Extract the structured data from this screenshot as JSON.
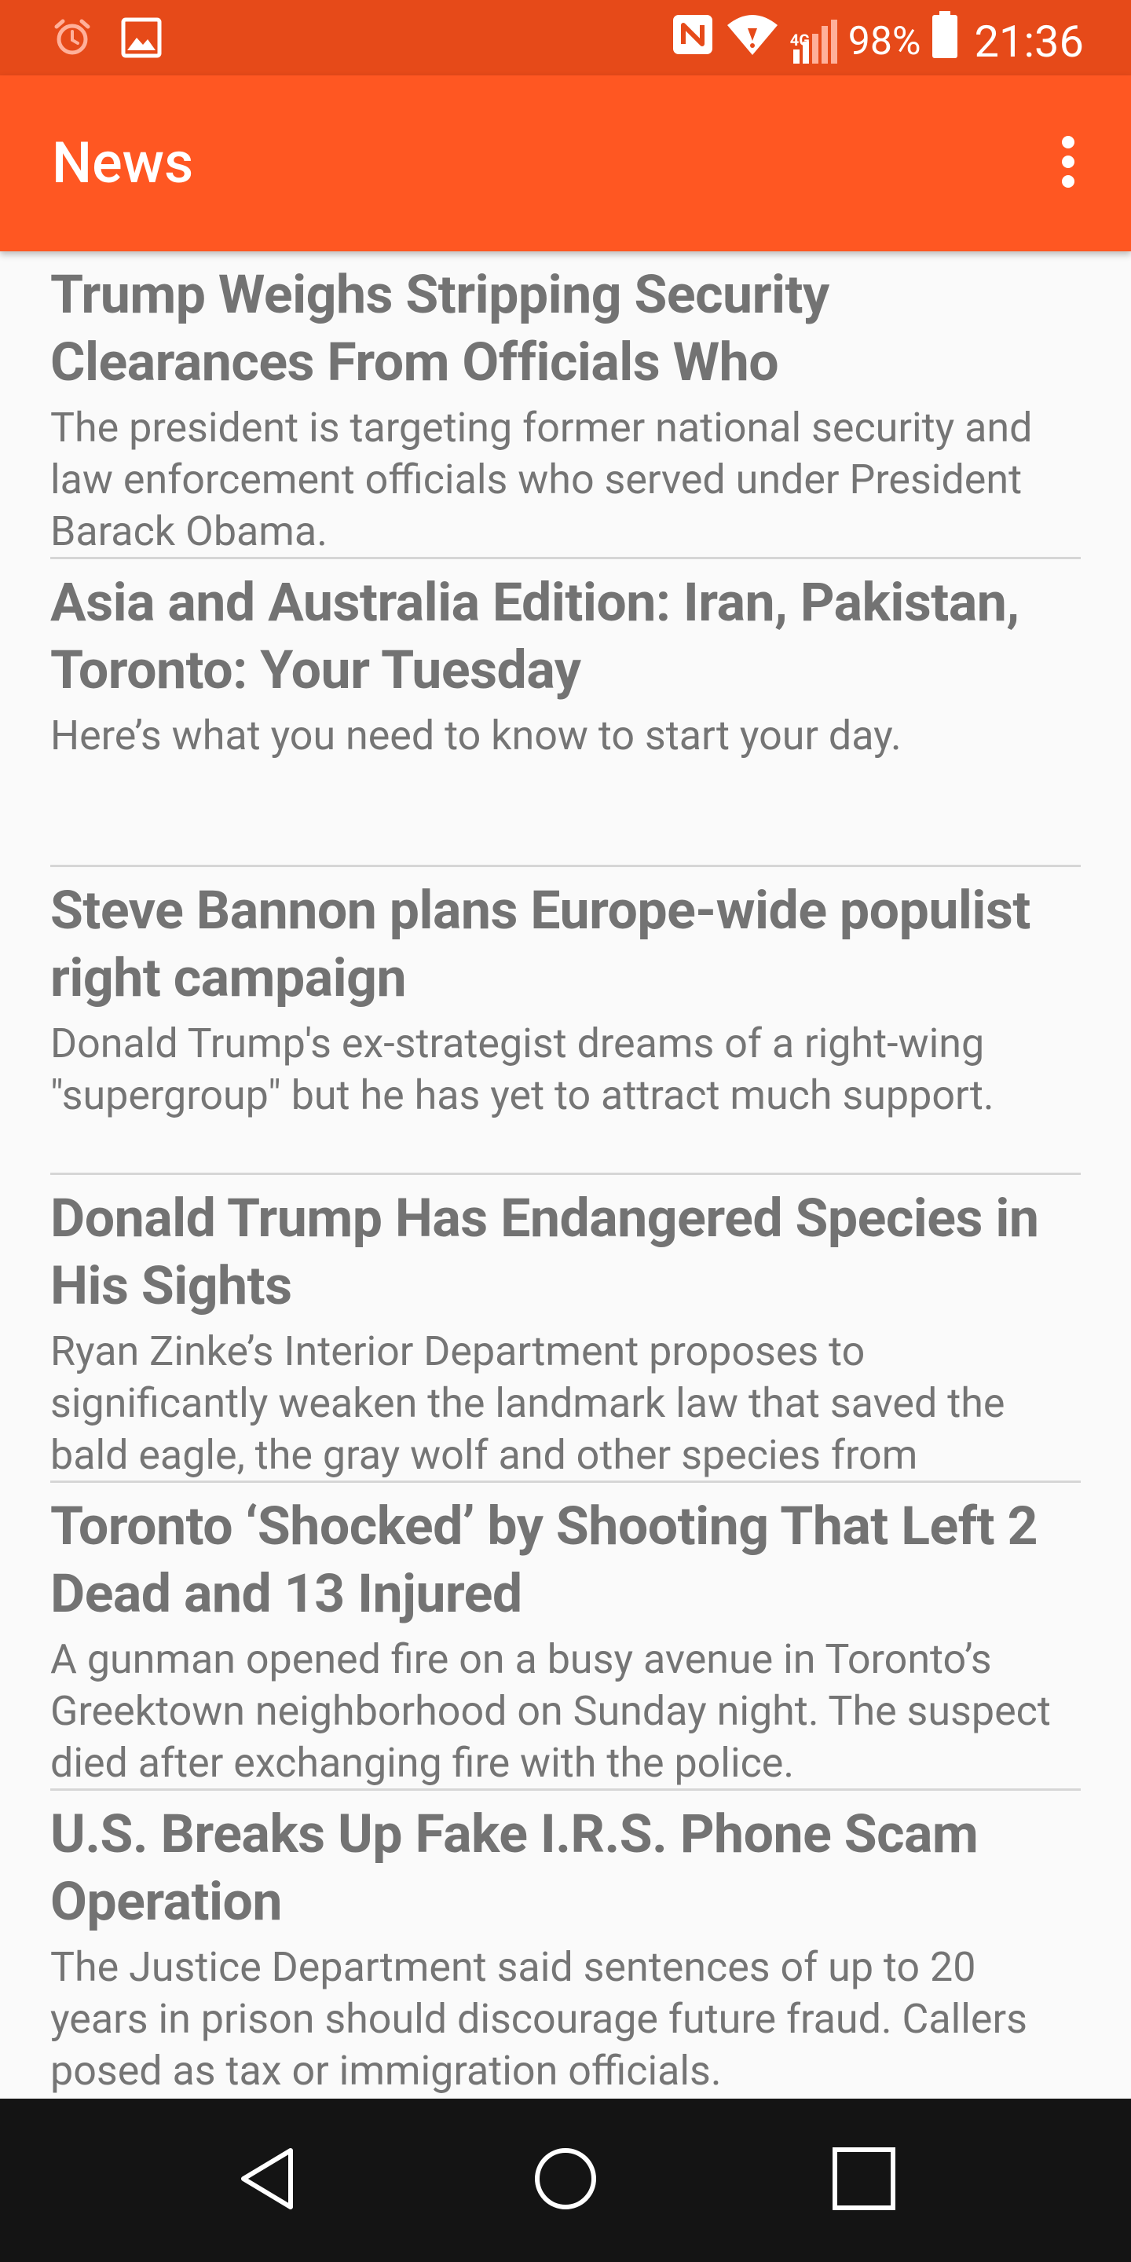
{
  "status_bar": {
    "battery_percent": "98%",
    "time": "21:36",
    "network_label": "4G",
    "left_icons": [
      "alarm-icon",
      "gallery-icon"
    ],
    "right_icons": [
      "nfc-icon",
      "wifi-icon",
      "signal-icon",
      "battery-icon"
    ]
  },
  "app_bar": {
    "title": "News",
    "menu_icon": "more-vertical-icon"
  },
  "news": [
    {
      "title": "Trump Weighs Stripping Security Clearances From Officials Who",
      "description": "The president is targeting former national security and law enforcement officials who served under President Barack Obama."
    },
    {
      "title": "Asia and Australia Edition: Iran, Pakistan, Toronto: Your Tuesday",
      "description": "Here’s what you need to know to start your day."
    },
    {
      "title": "Steve Bannon plans Europe-wide populist right campaign",
      "description": "Donald Trump's ex-strategist dreams of a right-wing \"supergroup\" but he has yet to attract much support."
    },
    {
      "title": "Donald Trump Has Endangered Species in His Sights",
      "description": "Ryan Zinke’s Interior Department proposes to significantly weaken the landmark law that saved the bald eagle, the gray wolf and other species from"
    },
    {
      "title": "Toronto ‘Shocked’ by Shooting That Left 2 Dead and 13 Injured",
      "description": "A gunman opened fire on a busy avenue in Toronto’s Greektown neighborhood on Sunday night. The suspect died after exchanging fire with the police."
    },
    {
      "title": "U.S. Breaks Up Fake I.R.S. Phone Scam Operation",
      "description": "The Justice Department said sentences of up to 20 years in prison should discourage future fraud. Callers posed as tax or immigration officials."
    }
  ],
  "nav_bar": {
    "buttons": [
      "back-icon",
      "home-icon",
      "recents-icon"
    ]
  },
  "colors": {
    "status_bar": "#e64a19",
    "app_bar": "#ff5722",
    "background": "#fafafa",
    "text": "#737373",
    "divider": "#d6d6d6",
    "nav_bar": "#141414"
  }
}
